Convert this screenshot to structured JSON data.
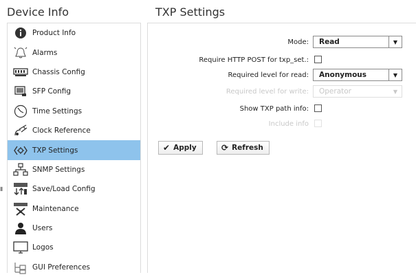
{
  "header": {
    "left_title": "Device Info",
    "right_title": "TXP Settings"
  },
  "sidebar": {
    "items": [
      {
        "label": "Product Info",
        "icon": "info-icon"
      },
      {
        "label": "Alarms",
        "icon": "bell-icon"
      },
      {
        "label": "Chassis Config",
        "icon": "chassis-icon"
      },
      {
        "label": "SFP Config",
        "icon": "sfp-icon"
      },
      {
        "label": "Time Settings",
        "icon": "clock-icon"
      },
      {
        "label": "Clock Reference",
        "icon": "satellite-icon"
      },
      {
        "label": "TXP Settings",
        "icon": "txp-icon",
        "active": true
      },
      {
        "label": "SNMP Settings",
        "icon": "network-icon"
      },
      {
        "label": "Save/Load Config",
        "icon": "save-load-icon"
      },
      {
        "label": "Maintenance",
        "icon": "maintenance-icon"
      },
      {
        "label": "Users",
        "icon": "user-icon"
      },
      {
        "label": "Logos",
        "icon": "monitor-icon"
      },
      {
        "label": "GUI Preferences",
        "icon": "preferences-icon"
      }
    ],
    "active_color": "#8ec3ec"
  },
  "form": {
    "mode_label": "Mode:",
    "mode_value": "Read",
    "require_post_label": "Require HTTP POST for txp_set.:",
    "require_post_checked": false,
    "read_level_label": "Required level for read:",
    "read_level_value": "Anonymous",
    "write_level_label": "Required level for write:",
    "write_level_value": "Operator",
    "show_path_label": "Show TXP path info:",
    "show_path_checked": false,
    "include_info_label": "Include info",
    "include_info_checked": false
  },
  "buttons": {
    "apply_label": "Apply",
    "refresh_label": "Refresh"
  }
}
